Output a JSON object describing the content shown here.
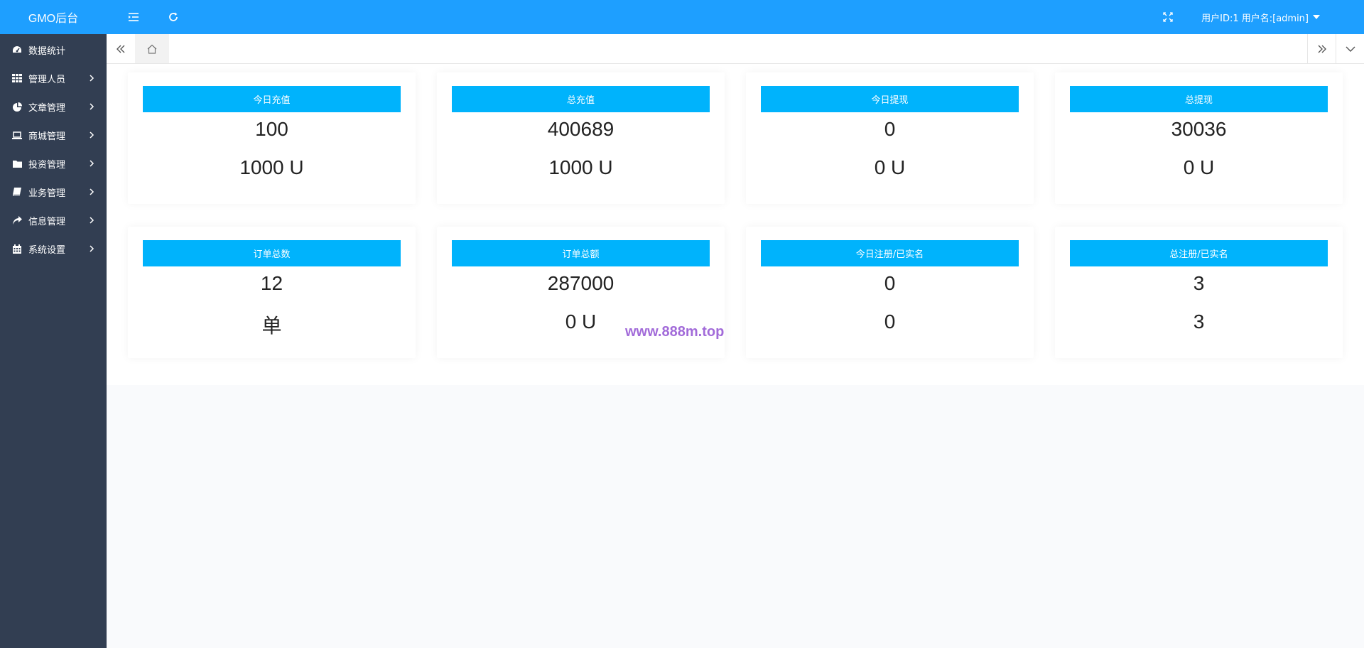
{
  "app": {
    "logo": "GMO后台"
  },
  "sidebar": {
    "items": [
      {
        "label": "数据统计",
        "icon": "dashboard-icon",
        "has_arrow": false
      },
      {
        "label": "管理人员",
        "icon": "grid-icon",
        "has_arrow": true
      },
      {
        "label": "文章管理",
        "icon": "pie-chart-icon",
        "has_arrow": true
      },
      {
        "label": "商城管理",
        "icon": "laptop-icon",
        "has_arrow": true
      },
      {
        "label": "投资管理",
        "icon": "folder-icon",
        "has_arrow": true
      },
      {
        "label": "业务管理",
        "icon": "book-icon",
        "has_arrow": true
      },
      {
        "label": "信息管理",
        "icon": "share-icon",
        "has_arrow": true
      },
      {
        "label": "系统设置",
        "icon": "calendar-icon",
        "has_arrow": true
      }
    ]
  },
  "header": {
    "user_text": "用户ID:1 用户名:[admin]"
  },
  "cards": [
    {
      "title": "今日充值",
      "value1": "100",
      "value2": "1000 U"
    },
    {
      "title": "总充值",
      "value1": "400689",
      "value2": "1000 U"
    },
    {
      "title": "今日提现",
      "value1": "0",
      "value2": "0 U"
    },
    {
      "title": "总提现",
      "value1": "30036",
      "value2": "0 U"
    },
    {
      "title": "订单总数",
      "value1": "12",
      "value2": "单"
    },
    {
      "title": "订单总额",
      "value1": "287000",
      "value2": "0 U"
    },
    {
      "title": "今日注册/已实名",
      "value1": "0",
      "value2": "0"
    },
    {
      "title": "总注册/已实名",
      "value1": "3",
      "value2": "3"
    }
  ],
  "watermark": "www.888m.top",
  "colors": {
    "header": "#1e9fff",
    "sidebar": "#323e52",
    "card_title": "#00b3fc"
  }
}
